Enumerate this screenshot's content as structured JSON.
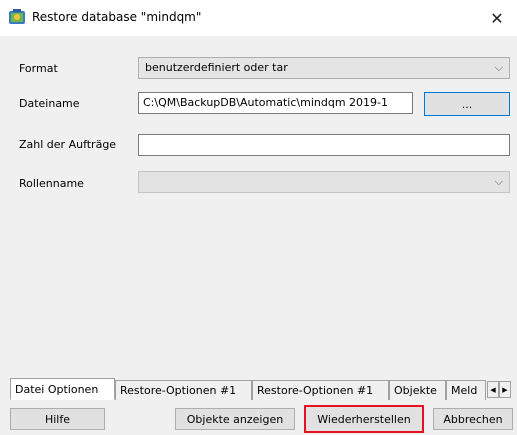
{
  "window": {
    "title": "Restore database \"mindqm\"",
    "close_symbol": "✕"
  },
  "form": {
    "format_label": "Format",
    "format_value": "benutzerdefiniert oder tar",
    "filename_label": "Dateiname",
    "filename_value": "C:\\QM\\BackupDB\\Automatic\\mindqm 2019-1",
    "browse_label": "...",
    "jobs_label": "Zahl der Aufträge",
    "jobs_value": "",
    "role_label": "Rollenname",
    "role_value": "",
    "dropdown_arrow": "⌵"
  },
  "tabs": [
    {
      "label": "Datei Optionen",
      "active": true
    },
    {
      "label": "Restore-Optionen #1",
      "active": false
    },
    {
      "label": "Restore-Optionen #1",
      "active": false
    },
    {
      "label": "Objekte",
      "active": false
    },
    {
      "label": "Meld",
      "active": false
    }
  ],
  "tab_scroll": {
    "left": "◀",
    "right": "▶"
  },
  "buttons": {
    "help": "Hilfe",
    "show_objects": "Objekte anzeigen",
    "restore": "Wiederherstellen",
    "cancel": "Abbrechen"
  }
}
